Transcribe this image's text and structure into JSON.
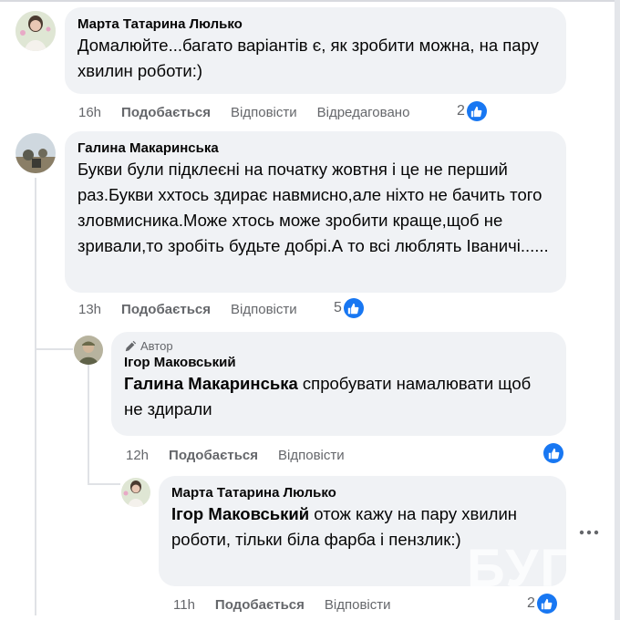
{
  "comments": [
    {
      "author": "Марта Татарина Люлько",
      "text": "Домалюйте...багато варіантів є, як зробити можна, на пару хвилин роботи:)",
      "time": "16h",
      "like_label": "Подобається",
      "reply_label": "Відповісти",
      "edited_label": "Відредаговано",
      "reactions": "2"
    },
    {
      "author": "Галина Макаринська",
      "text": "Букви були підклеєні на початку жовтня і це не перший раз.Букви ххтось здирає навмисно,але ніхто не бачить того зловмисника.Може хтось може зробити краще,щоб не зривали,то зробіть будьте добрі.А то всі люблять Іваничі......",
      "time": "13h",
      "like_label": "Подобається",
      "reply_label": "Відповісти",
      "reactions": "5"
    },
    {
      "badge": "Автор",
      "author": "Ігор Маковський",
      "mention": "Галина Макаринська",
      "text": " спробувати намалювати щоб не здирали",
      "time": "12h",
      "like_label": "Подобається",
      "reply_label": "Відповісти"
    },
    {
      "author": "Марта Татарина Люлько",
      "mention": "Ігор Маковський",
      "text": " отож кажу на пару хвилин роботи, тільки біла фарба і пензлик:)",
      "time": "11h",
      "like_label": "Подобається",
      "reply_label": "Відповісти",
      "reactions": "2"
    }
  ],
  "icons": {
    "like": "thumbs-up-icon",
    "more": "more-options-icon",
    "author": "pencil-icon"
  },
  "colors": {
    "like_blue": "#1877f2",
    "bubble": "#f0f2f5",
    "secondary_text": "#65676b"
  },
  "watermark": "БУГ"
}
